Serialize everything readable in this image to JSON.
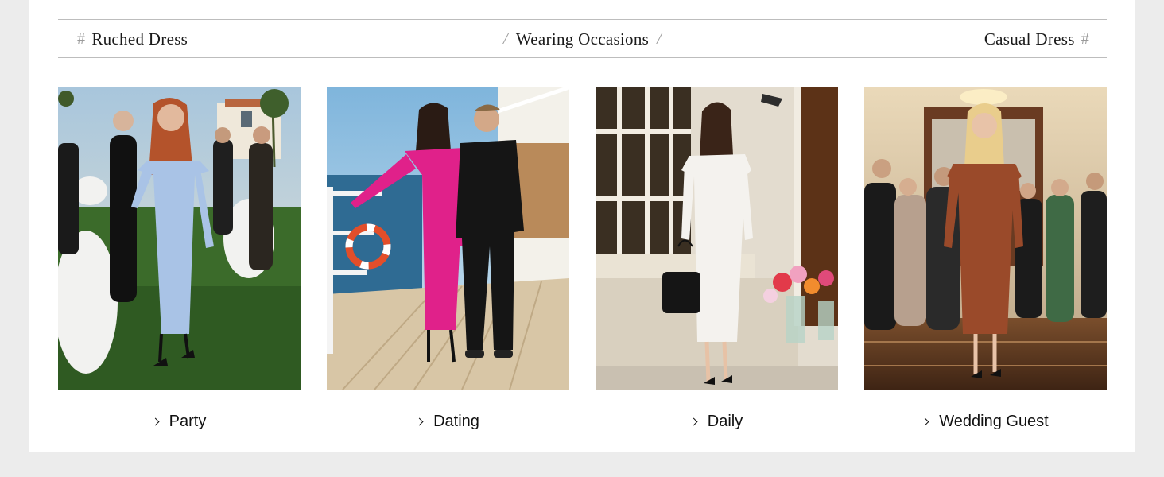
{
  "header": {
    "left_label": "Ruched Dress",
    "center_label": "Wearing Occasions",
    "right_label": "Casual Dress",
    "deco_hash": "#",
    "deco_slash": "/"
  },
  "occasions": [
    {
      "label": "Party",
      "dress_color": "#a9c3e6",
      "scene": "garden party at dusk"
    },
    {
      "label": "Dating",
      "dress_color": "#e0218a",
      "scene": "cruise ship deck"
    },
    {
      "label": "Daily",
      "dress_color": "#f4f2ee",
      "scene": "street cafe storefront"
    },
    {
      "label": "Wedding Guest",
      "dress_color": "#9a4a2a",
      "scene": "ballroom reception"
    }
  ],
  "icons": {
    "bullet": "chevron-right-icon"
  }
}
